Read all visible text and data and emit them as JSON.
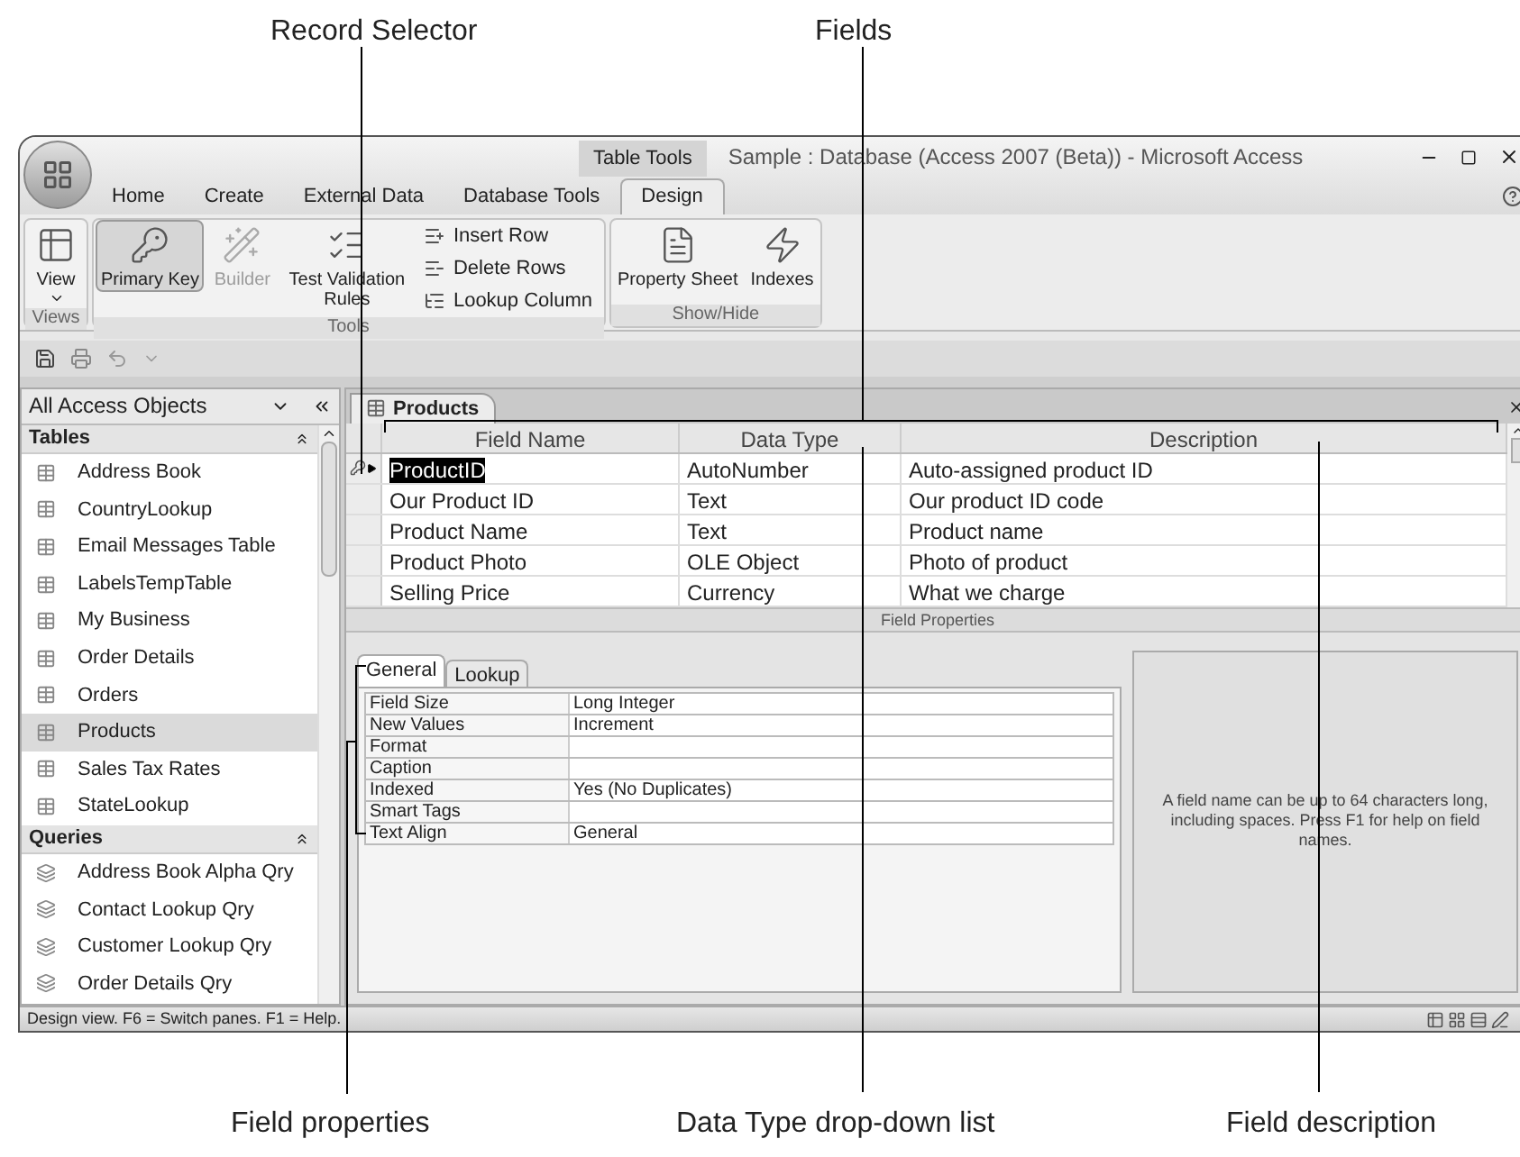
{
  "callouts_top": [
    "Record Selector",
    "Fields"
  ],
  "callouts_bottom": [
    "Field properties",
    "Data Type drop-down list",
    "Field description"
  ],
  "window": {
    "title": "Sample : Database (Access 2007 (Beta)) - Microsoft Access",
    "contextual_tab": "Table Tools"
  },
  "ribbon_tabs": [
    {
      "label": "Home",
      "selected": false
    },
    {
      "label": "Create",
      "selected": false
    },
    {
      "label": "External Data",
      "selected": false
    },
    {
      "label": "Database Tools",
      "selected": false
    },
    {
      "label": "Design",
      "selected": true
    }
  ],
  "ribbon_groups": [
    {
      "label": "Views",
      "buttons": [
        {
          "label": "View",
          "kind": "dropdown",
          "selected": false,
          "disabled": false
        }
      ]
    },
    {
      "label": "Tools",
      "buttons": [
        {
          "label": "Primary Key",
          "kind": "large",
          "selected": true,
          "disabled": false
        },
        {
          "label": "Builder",
          "kind": "large",
          "selected": false,
          "disabled": true
        },
        {
          "label": "Test Validation Rules",
          "kind": "large",
          "selected": false,
          "disabled": false
        },
        {
          "label": "Insert Row",
          "kind": "small",
          "selected": false,
          "disabled": false
        },
        {
          "label": "Delete Rows",
          "kind": "small",
          "selected": false,
          "disabled": false
        },
        {
          "label": "Lookup Column",
          "kind": "small",
          "selected": false,
          "disabled": false
        }
      ]
    },
    {
      "label": "Show/Hide",
      "buttons": [
        {
          "label": "Property Sheet",
          "kind": "large",
          "selected": false,
          "disabled": false
        },
        {
          "label": "Indexes",
          "kind": "large",
          "selected": false,
          "disabled": false
        }
      ]
    }
  ],
  "navigation": {
    "title": "All Access Objects",
    "sections": [
      {
        "label": "Tables",
        "kind": "table",
        "items": [
          {
            "label": "Address Book",
            "selected": false
          },
          {
            "label": "CountryLookup",
            "selected": false
          },
          {
            "label": "Email Messages Table",
            "selected": false
          },
          {
            "label": "LabelsTempTable",
            "selected": false
          },
          {
            "label": "My Business",
            "selected": false
          },
          {
            "label": "Order Details",
            "selected": false
          },
          {
            "label": "Orders",
            "selected": false
          },
          {
            "label": "Products",
            "selected": true
          },
          {
            "label": "Sales Tax Rates",
            "selected": false
          },
          {
            "label": "StateLookup",
            "selected": false
          }
        ]
      },
      {
        "label": "Queries",
        "kind": "query",
        "items": [
          {
            "label": "Address Book Alpha Qry",
            "selected": false
          },
          {
            "label": "Contact Lookup Qry",
            "selected": false
          },
          {
            "label": "Customer Lookup Qry",
            "selected": false
          },
          {
            "label": "Order Details Qry",
            "selected": false
          }
        ]
      }
    ]
  },
  "document_tab": {
    "label": "Products"
  },
  "table": {
    "columns": [
      "Field Name",
      "Data Type",
      "Description"
    ],
    "rows": [
      {
        "cells": [
          "ProductID",
          "AutoNumber",
          "Auto-assigned product ID"
        ],
        "selected": true,
        "primary_key": true
      },
      {
        "cells": [
          "Our Product ID",
          "Text",
          "Our product ID code"
        ],
        "selected": false,
        "primary_key": false
      },
      {
        "cells": [
          "Product Name",
          "Text",
          "Product name"
        ],
        "selected": false,
        "primary_key": false
      },
      {
        "cells": [
          "Product Photo",
          "OLE Object",
          "Photo of product"
        ],
        "selected": false,
        "primary_key": false
      },
      {
        "cells": [
          "Selling Price",
          "Currency",
          "What we charge"
        ],
        "selected": false,
        "primary_key": false
      }
    ]
  },
  "field_properties": {
    "title": "Field Properties",
    "tabs": [
      {
        "label": "General",
        "selected": true
      },
      {
        "label": "Lookup",
        "selected": false
      }
    ],
    "properties": [
      {
        "name": "Field Size",
        "value": "Long Integer"
      },
      {
        "name": "New Values",
        "value": "Increment"
      },
      {
        "name": "Format"
      },
      {
        "name": "Caption"
      },
      {
        "name": "Indexed",
        "value": "Yes (No Duplicates)"
      },
      {
        "name": "Smart Tags"
      },
      {
        "name": "Text Align",
        "value": "General"
      }
    ],
    "help": "A field name can be up to 64 characters long, including spaces.  Press F1 for help on field names."
  },
  "status_bar": {
    "text": "Design view.  F6 = Switch panes.  F1 = Help."
  }
}
